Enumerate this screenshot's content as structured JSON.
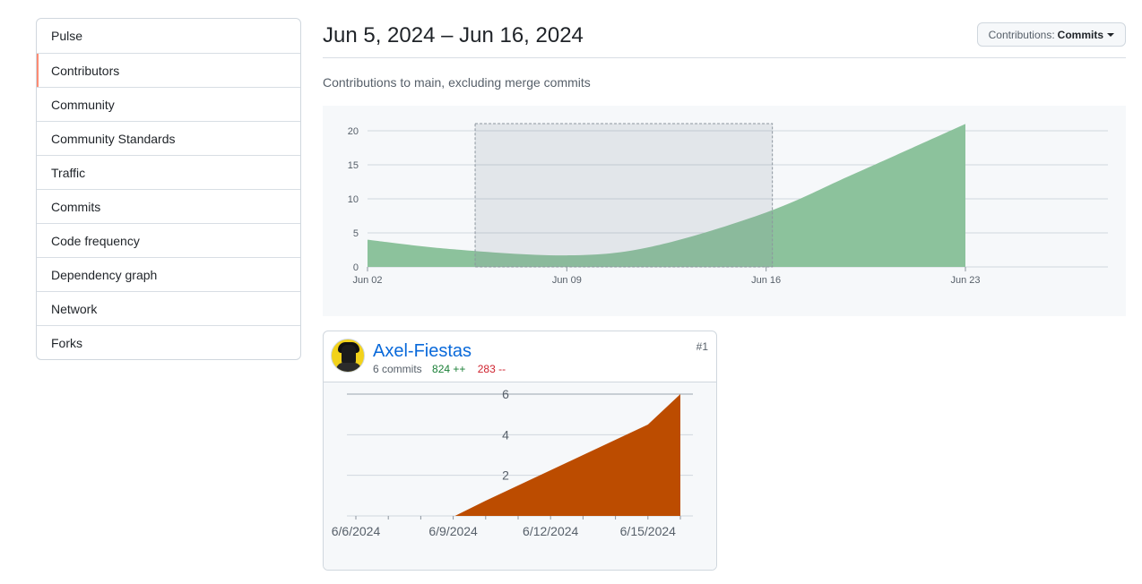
{
  "sidebar": {
    "items": [
      {
        "label": "Pulse",
        "selected": false
      },
      {
        "label": "Contributors",
        "selected": true
      },
      {
        "label": "Community",
        "selected": false
      },
      {
        "label": "Community Standards",
        "selected": false
      },
      {
        "label": "Traffic",
        "selected": false
      },
      {
        "label": "Commits",
        "selected": false
      },
      {
        "label": "Code frequency",
        "selected": false
      },
      {
        "label": "Dependency graph",
        "selected": false
      },
      {
        "label": "Network",
        "selected": false
      },
      {
        "label": "Forks",
        "selected": false
      }
    ]
  },
  "header": {
    "range_title": "Jun 5, 2024 – Jun 16, 2024",
    "contributions_label": "Contributions:",
    "contributions_value": "Commits"
  },
  "subtitle": "Contributions to main, excluding merge commits",
  "colors": {
    "accent_selected": "#fd8c73",
    "main_area": "#8cc29c",
    "contributor_area": "#bc4c00",
    "link": "#0969da",
    "additions": "#1a7f37",
    "deletions": "#cf222e"
  },
  "chart_data": [
    {
      "type": "area",
      "x": [
        "Jun 02",
        "Jun 05",
        "Jun 09",
        "Jun 12",
        "Jun 16",
        "Jun 19",
        "Jun 23"
      ],
      "xticks": [
        "Jun 02",
        "Jun 09",
        "Jun 16",
        "Jun 23"
      ],
      "series": [
        {
          "values": [
            4,
            2.6,
            1.7,
            3.0,
            8.0,
            13.5,
            21
          ]
        }
      ],
      "yticks": [
        0,
        5,
        10,
        15,
        20
      ],
      "ylim": [
        0,
        20
      ],
      "selection": [
        "Jun 06",
        "Jun 16"
      ],
      "grid": true
    },
    {
      "type": "area",
      "x": [
        "6/6/2024",
        "6/7/2024",
        "6/8/2024",
        "6/9/2024",
        "6/10/2024",
        "6/11/2024",
        "6/12/2024",
        "6/13/2024",
        "6/14/2024",
        "6/15/2024",
        "6/16/2024"
      ],
      "xticks": [
        "6/6/2024",
        "6/9/2024",
        "6/12/2024",
        "6/15/2024"
      ],
      "series": [
        {
          "values": [
            0,
            0,
            0,
            0,
            0.75,
            1.5,
            2.25,
            3.0,
            3.75,
            4.5,
            6
          ]
        }
      ],
      "yticks": [
        2,
        4,
        6
      ],
      "ylim": [
        0,
        6
      ],
      "grid": true
    }
  ],
  "contributors": [
    {
      "name": "Axel-Fiestas",
      "commits": "6 commits",
      "additions": "824 ++",
      "deletions": "283 --",
      "rank": "#1"
    }
  ]
}
